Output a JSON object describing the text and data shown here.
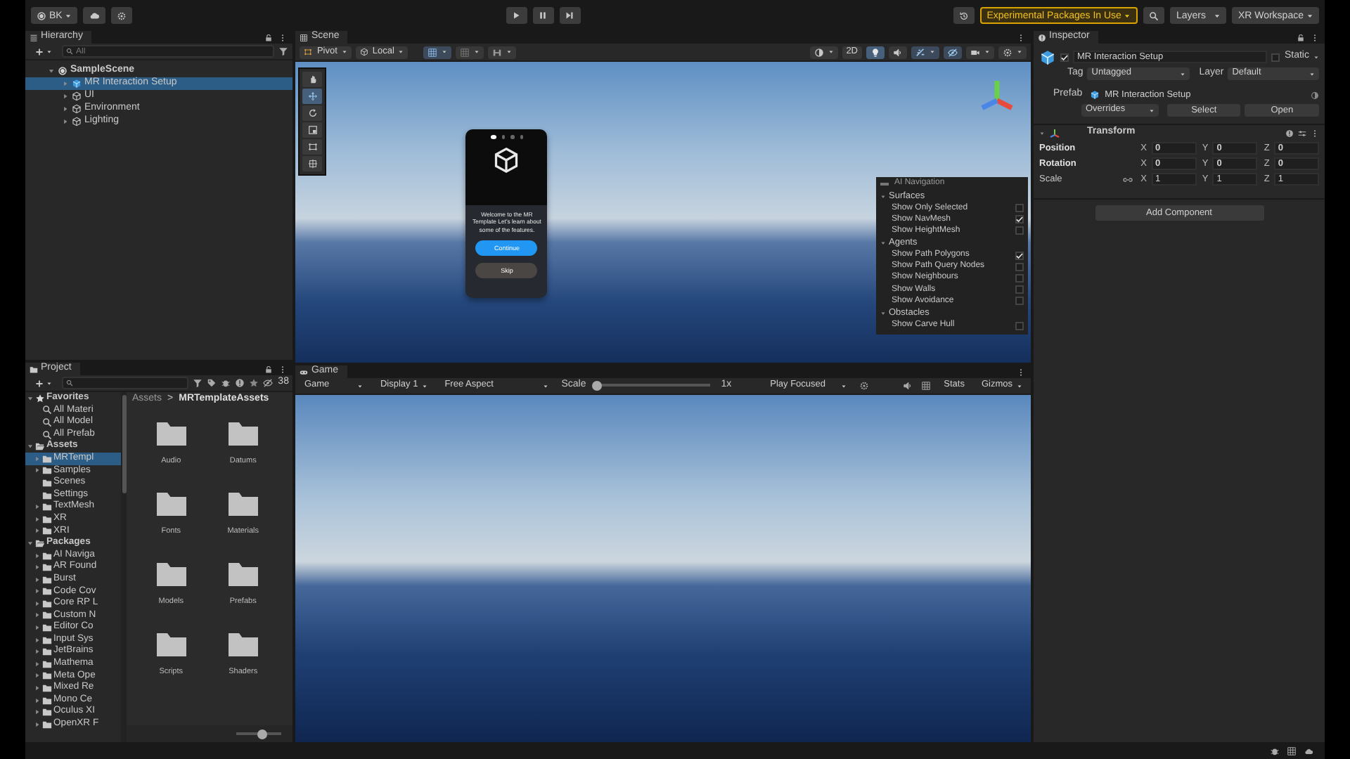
{
  "toolbar": {
    "account": "BK",
    "experimental": "Experimental Packages In Use",
    "layers": "Layers",
    "layout": "XR Workspace"
  },
  "hierarchy": {
    "title": "Hierarchy",
    "search_placeholder": "All",
    "items": [
      {
        "label": "SampleScene",
        "kind": "scene",
        "selected": false,
        "expanded": true,
        "children": [
          {
            "label": "MR Interaction Setup",
            "kind": "prefab",
            "selected": true,
            "expanded": false
          },
          {
            "label": "UI",
            "kind": "object",
            "selected": false,
            "expanded": false
          },
          {
            "label": "Environment",
            "kind": "object",
            "selected": false,
            "expanded": false
          },
          {
            "label": "Lighting",
            "kind": "object",
            "selected": false,
            "expanded": false
          }
        ]
      }
    ]
  },
  "scene": {
    "title": "Scene",
    "pivot": "Pivot",
    "space": "Local",
    "view_2d": "2D",
    "view_2d_on": false,
    "lighting_on": true,
    "tools": [
      {
        "kind": "hand",
        "selected": false
      },
      {
        "kind": "move",
        "selected": true
      },
      {
        "kind": "rotate",
        "selected": false
      },
      {
        "kind": "scale",
        "selected": false
      },
      {
        "kind": "rect",
        "selected": false
      },
      {
        "kind": "transform",
        "selected": false
      }
    ],
    "welcome_card": {
      "pages": [
        {
          "selected": true
        },
        {
          "selected": false
        },
        {
          "selected": false
        },
        {
          "selected": false
        }
      ],
      "message": "Welcome to the MR Template Let's learn about some of the features.",
      "primary": "Continue",
      "secondary": "Skip"
    },
    "ai_navigation": {
      "title": "AI Navigation",
      "sections": [
        {
          "title": "Surfaces",
          "expanded": true,
          "options": [
            {
              "label": "Show Only Selected",
              "checked": false
            },
            {
              "label": "Show NavMesh",
              "checked": true
            },
            {
              "label": "Show HeightMesh",
              "checked": false
            }
          ]
        },
        {
          "title": "Agents",
          "expanded": true,
          "options": [
            {
              "label": "Show Path Polygons",
              "checked": true
            },
            {
              "label": "Show Path Query Nodes",
              "checked": false
            },
            {
              "label": "Show Neighbours",
              "checked": false
            },
            {
              "label": "Show Walls",
              "checked": false
            },
            {
              "label": "Show Avoidance",
              "checked": false
            }
          ]
        },
        {
          "title": "Obstacles",
          "expanded": true,
          "options": [
            {
              "label": "Show Carve Hull",
              "checked": false
            }
          ]
        }
      ]
    }
  },
  "game": {
    "title": "Game",
    "mode": "Game",
    "display": "Display 1",
    "aspect": "Free Aspect",
    "scale_label": "Scale",
    "scale_slider": {
      "level": 0
    },
    "scale_value": "1x",
    "play_mode": "Play Focused",
    "stats": "Stats",
    "gizmos": "Gizmos"
  },
  "project": {
    "title": "Project",
    "count": "38",
    "breadcrumb": [
      "Assets",
      "MRTemplateAssets"
    ],
    "breadcrumb_separator": ">",
    "tree": [
      {
        "label": "Favorites",
        "kind": "favorites",
        "selected": false,
        "expanded": true,
        "children": [
          {
            "label": "All Materi",
            "kind": "search",
            "selected": false
          },
          {
            "label": "All Model",
            "kind": "search",
            "selected": false
          },
          {
            "label": "All Prefab",
            "kind": "search",
            "selected": false
          }
        ]
      },
      {
        "label": "Assets",
        "kind": "root",
        "selected": false,
        "expanded": true,
        "children": [
          {
            "label": "MRTempl",
            "kind": "folder",
            "selected": true,
            "expanded": false
          },
          {
            "label": "Samples",
            "kind": "folder",
            "selected": false,
            "expanded": false
          },
          {
            "label": "Scenes",
            "kind": "folder",
            "selected": false
          },
          {
            "label": "Settings",
            "kind": "folder",
            "selected": false
          },
          {
            "label": "TextMesh",
            "kind": "folder",
            "selected": false,
            "expanded": false
          },
          {
            "label": "XR",
            "kind": "folder",
            "selected": false,
            "expanded": false
          },
          {
            "label": "XRI",
            "kind": "folder",
            "selected": false,
            "expanded": false
          }
        ]
      },
      {
        "label": "Packages",
        "kind": "root",
        "selected": false,
        "expanded": true,
        "children": [
          {
            "label": "AI Naviga",
            "kind": "folder",
            "selected": false,
            "expanded": false
          },
          {
            "label": "AR Found",
            "kind": "folder",
            "selected": false,
            "expanded": false
          },
          {
            "label": "Burst",
            "kind": "folder",
            "selected": false,
            "expanded": false
          },
          {
            "label": "Code Cov",
            "kind": "folder",
            "selected": false,
            "expanded": false
          },
          {
            "label": "Core RP L",
            "kind": "folder",
            "selected": false,
            "expanded": false
          },
          {
            "label": "Custom N",
            "kind": "folder",
            "selected": false,
            "expanded": false
          },
          {
            "label": "Editor Co",
            "kind": "folder",
            "selected": false,
            "expanded": false
          },
          {
            "label": "Input Sys",
            "kind": "folder",
            "selected": false,
            "expanded": false
          },
          {
            "label": "JetBrains",
            "kind": "folder",
            "selected": false,
            "expanded": false
          },
          {
            "label": "Mathema",
            "kind": "folder",
            "selected": false,
            "expanded": false
          },
          {
            "label": "Meta Ope",
            "kind": "folder",
            "selected": false,
            "expanded": false
          },
          {
            "label": "Mixed Re",
            "kind": "folder",
            "selected": false,
            "expanded": false
          },
          {
            "label": "Mono Ce",
            "kind": "folder",
            "selected": false,
            "expanded": false
          },
          {
            "label": "Oculus XI",
            "kind": "folder",
            "selected": false,
            "expanded": false
          },
          {
            "label": "OpenXR F",
            "kind": "folder",
            "selected": false,
            "expanded": false
          }
        ]
      }
    ],
    "folders": [
      "Audio",
      "Datums",
      "Fonts",
      "Materials",
      "Models",
      "Prefabs",
      "Scripts",
      "Shaders"
    ],
    "icon_size": {
      "level": 0.55
    }
  },
  "inspector": {
    "title": "Inspector",
    "active": true,
    "name": "MR Interaction Setup",
    "static_label": "Static",
    "static": false,
    "tag_label": "Tag",
    "tag": "Untagged",
    "layer_label": "Layer",
    "layer": "Default",
    "prefab_label": "Prefab",
    "prefab": "MR Interaction Setup",
    "overrides": "Overrides",
    "select": "Select",
    "open": "Open",
    "component": {
      "title": "Transform",
      "expanded": true,
      "rows": [
        {
          "label": "Position",
          "kind": "vector",
          "overridden": true,
          "values": [
            {
              "axis": "X",
              "value": "0"
            },
            {
              "axis": "Y",
              "value": "0"
            },
            {
              "axis": "Z",
              "value": "0"
            }
          ]
        },
        {
          "label": "Rotation",
          "kind": "vector",
          "overridden": true,
          "values": [
            {
              "axis": "X",
              "value": "0"
            },
            {
              "axis": "Y",
              "value": "0"
            },
            {
              "axis": "Z",
              "value": "0"
            }
          ]
        },
        {
          "label": "Scale",
          "kind": "scale",
          "overridden": false,
          "values": [
            {
              "axis": "X",
              "value": "1"
            },
            {
              "axis": "Y",
              "value": "1"
            },
            {
              "axis": "Z",
              "value": "1"
            }
          ]
        }
      ]
    },
    "add_component": "Add Component"
  }
}
